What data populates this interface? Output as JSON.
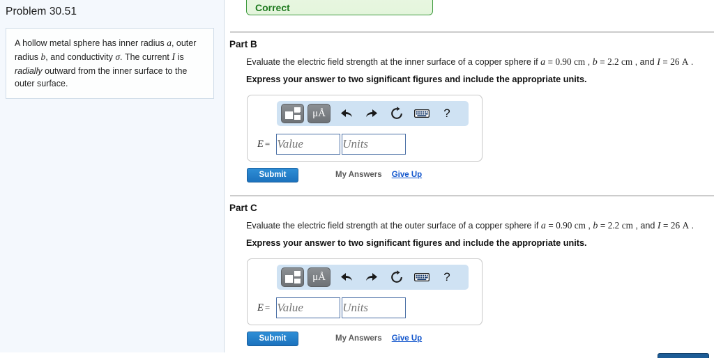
{
  "left_panel": {
    "problem_title": "Problem 30.51",
    "problem_statement": {
      "seg1": "A hollow metal sphere has inner radius ",
      "var_a": "a",
      "seg2": ", outer radius ",
      "var_b": "b",
      "seg3": ", and conductivity ",
      "var_sigma": "σ",
      "seg4": ". The current ",
      "var_I": "I",
      "seg5": " is ",
      "em_radially": "radially",
      "seg6": " outward from the inner surface to the outer surface."
    }
  },
  "feedback": {
    "correct_label": "Correct"
  },
  "parts": [
    {
      "heading": "Part B",
      "question": {
        "lead": "Evaluate the electric field strength at the inner surface of a copper sphere if ",
        "var_a": "a",
        "eq1": " = ",
        "val_a": "0.90",
        "unit_a": "cm",
        "sep1": " , ",
        "var_b": "b",
        "eq2": " = ",
        "val_b": "2.2",
        "unit_b": "cm",
        "sep2": " , and ",
        "var_I": "I",
        "eq3": " = ",
        "val_I": "26",
        "unit_I": "A",
        "tail": " ."
      },
      "instruction": "Express your answer to two significant figures and include the appropriate units.",
      "toolbar": {
        "template_button": "template-icon",
        "units_button": "μÅ",
        "undo": "↶",
        "redo": "↷",
        "reset": "↻",
        "keyboard": "keyboard-icon",
        "help": "?"
      },
      "answer": {
        "symbol": "E",
        "equals": "=",
        "value_placeholder": "Value",
        "units_placeholder": "Units",
        "value": "",
        "units": ""
      },
      "actions": {
        "submit": "Submit",
        "my_answers": "My Answers",
        "give_up": "Give Up"
      }
    },
    {
      "heading": "Part C",
      "question": {
        "lead": "Evaluate the electric field strength at the outer surface of a copper sphere if ",
        "var_a": "a",
        "eq1": " = ",
        "val_a": "0.90",
        "unit_a": "cm",
        "sep1": " , ",
        "var_b": "b",
        "eq2": " = ",
        "val_b": "2.2",
        "unit_b": "cm",
        "sep2": " , and ",
        "var_I": "I",
        "eq3": " = ",
        "val_I": "26",
        "unit_I": "A",
        "tail": " ."
      },
      "instruction": "Express your answer to two significant figures and include the appropriate units.",
      "toolbar": {
        "template_button": "template-icon",
        "units_button": "μÅ",
        "undo": "↶",
        "redo": "↷",
        "reset": "↻",
        "keyboard": "keyboard-icon",
        "help": "?"
      },
      "answer": {
        "symbol": "E",
        "equals": "=",
        "value_placeholder": "Value",
        "units_placeholder": "Units",
        "value": "",
        "units": ""
      },
      "actions": {
        "submit": "Submit",
        "my_answers": "My Answers",
        "give_up": "Give Up"
      }
    }
  ],
  "colors": {
    "accent_blue": "#1c72bd",
    "link_blue": "#1155cc",
    "correct_green": "#1f7a1f",
    "panel_bg": "#f4f8fd",
    "toolbar_bg": "#cfe2f3"
  }
}
